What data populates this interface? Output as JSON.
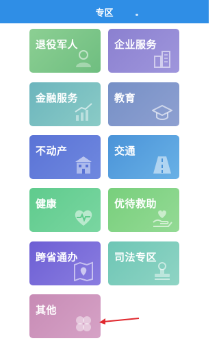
{
  "header": {
    "title": "专区"
  },
  "tiles": [
    {
      "label": "退役军人",
      "icon": "person-bust-icon"
    },
    {
      "label": "企业服务",
      "icon": "buildings-icon"
    },
    {
      "label": "金融服务",
      "icon": "bar-trend-icon"
    },
    {
      "label": "教育",
      "icon": "graduation-cap-icon"
    },
    {
      "label": "不动产",
      "icon": "building-icon"
    },
    {
      "label": "交通",
      "icon": "road-icon"
    },
    {
      "label": "健康",
      "icon": "heart-pulse-icon"
    },
    {
      "label": "优待救助",
      "icon": "hand-heart-icon"
    },
    {
      "label": "跨省通办",
      "icon": "map-pin-icon"
    },
    {
      "label": "司法专区",
      "icon": "stamp-icon"
    },
    {
      "label": "其他",
      "icon": "four-petal-icon"
    }
  ],
  "annotation": {
    "arrow_color": "#e0282e"
  }
}
